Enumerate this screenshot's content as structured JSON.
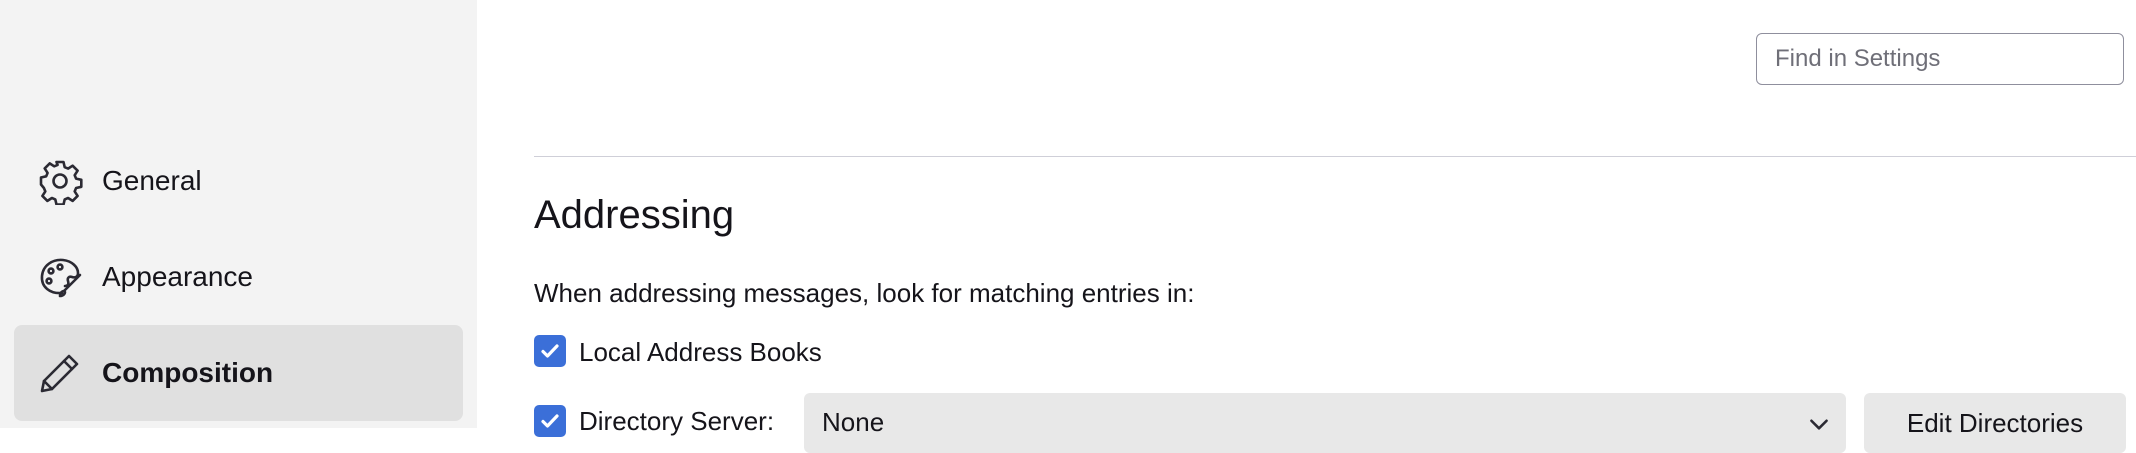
{
  "sidebar": {
    "items": [
      {
        "label": "General",
        "icon": "gear-icon",
        "selected": false
      },
      {
        "label": "Appearance",
        "icon": "palette-icon",
        "selected": false
      },
      {
        "label": "Composition",
        "icon": "pencil-icon",
        "selected": true
      }
    ]
  },
  "search": {
    "placeholder": "Find in Settings"
  },
  "addressing": {
    "heading": "Addressing",
    "intro": "When addressing messages, look for matching entries in:",
    "local_address_books": {
      "label": "Local Address Books",
      "checked": true
    },
    "directory_server": {
      "label": "Directory Server:",
      "checked": true,
      "selected_value": "None"
    },
    "edit_directories_label": "Edit Directories"
  },
  "colors": {
    "accent": "#3b6fd8",
    "sidebar_bg": "#f3f3f3",
    "selected_bg": "#e0e0e0"
  }
}
